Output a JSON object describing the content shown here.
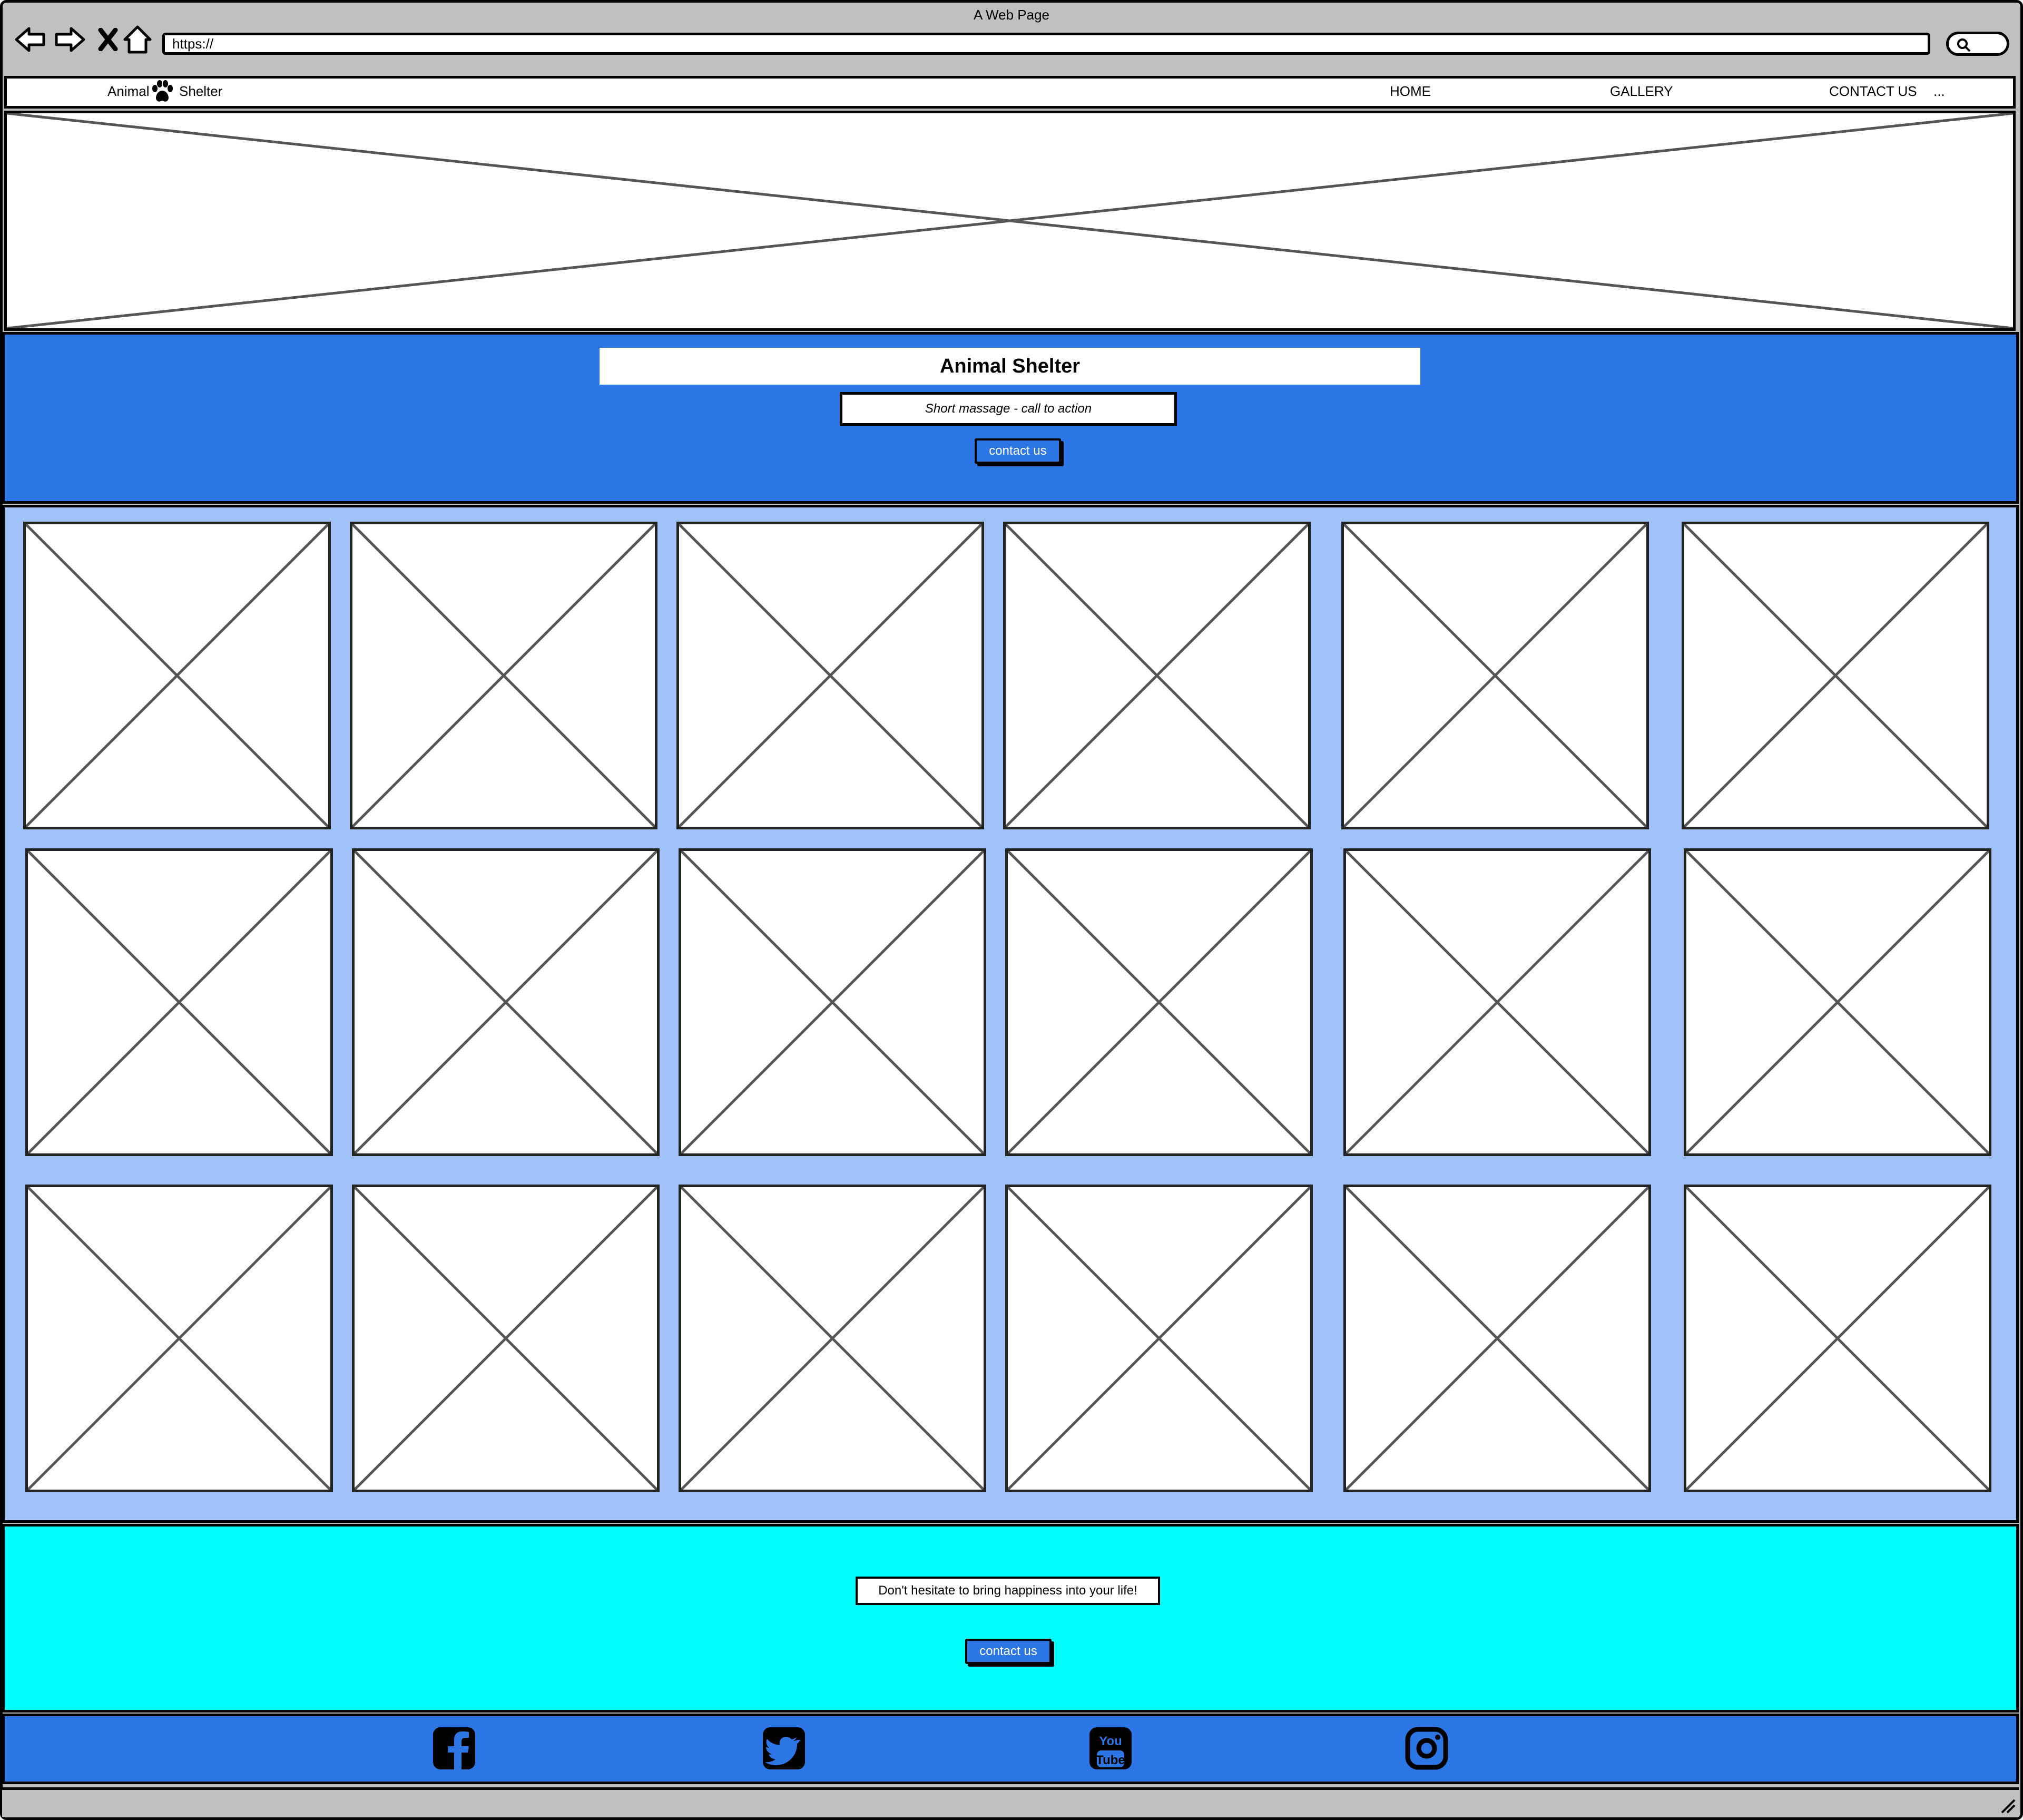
{
  "window": {
    "title": "A Web Page",
    "url": "https://",
    "buttons": [
      "back-icon",
      "forward-icon",
      "close-icon",
      "home-icon"
    ]
  },
  "header": {
    "logo_left": "Animal",
    "logo_icon": "paw-icon",
    "logo_right": "Shelter",
    "nav": [
      {
        "label": "HOME"
      },
      {
        "label": "GALLERY"
      },
      {
        "label": "CONTACT US"
      },
      {
        "label": "..."
      }
    ]
  },
  "hero": {
    "title": "Animal Shelter",
    "message": "Short massage - call to action",
    "button": "contact us"
  },
  "gallery": {
    "rows": 3,
    "columns": 6,
    "tile_icon": "image-placeholder-icon"
  },
  "footer_cta": {
    "message": "Don't hesitate to bring happiness into your life!",
    "button": "contact us"
  },
  "social": [
    {
      "name": "facebook-icon",
      "text": "f"
    },
    {
      "name": "twitter-icon",
      "text": ""
    },
    {
      "name": "youtube-icon",
      "text": "You Tube"
    },
    {
      "name": "instagram-icon",
      "text": ""
    }
  ],
  "colors": {
    "primary_blue": "#2c76e6",
    "gallery_bg": "#9fc3f8",
    "footer_cta_bg": "#00ffff",
    "chrome_gray": "#c0c0c0"
  }
}
